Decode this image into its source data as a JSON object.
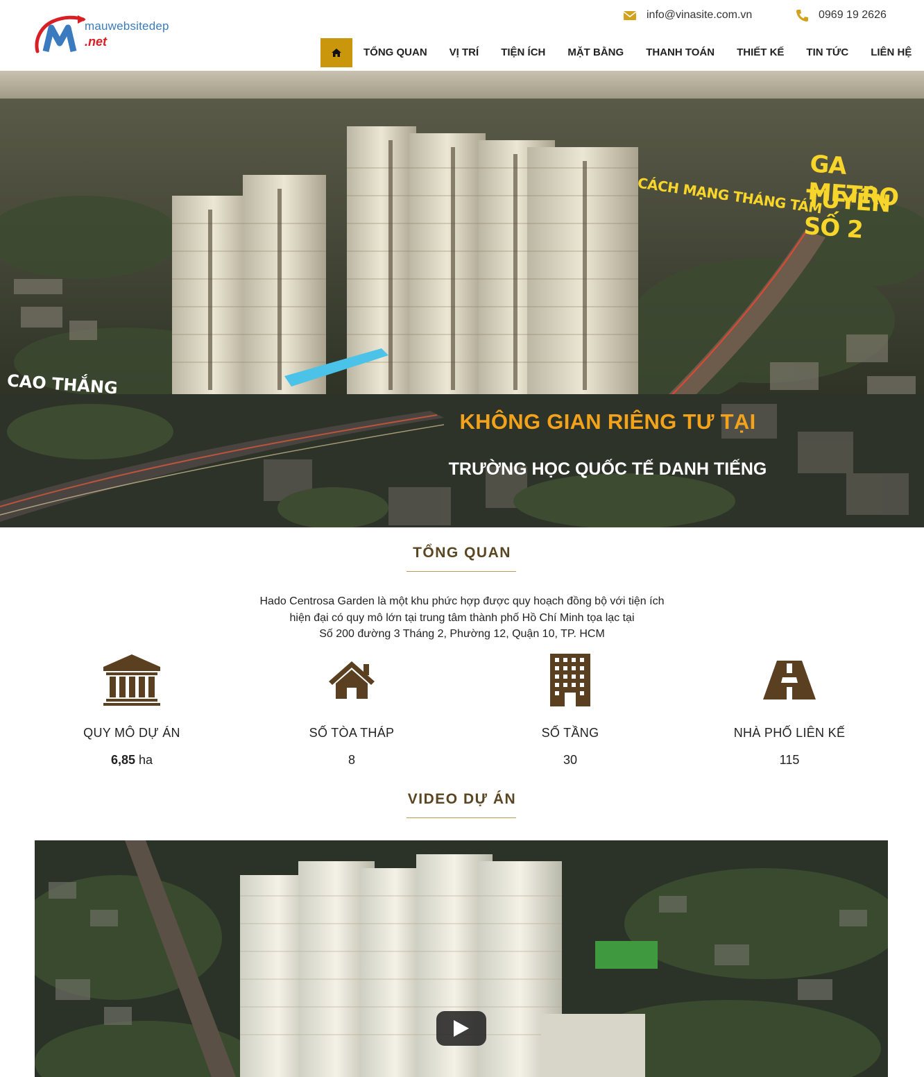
{
  "header": {
    "logo": {
      "line1": "mauwebsitedep",
      "line2": ".net"
    },
    "contact": {
      "email_icon": "envelope-icon",
      "email": "info@vinasite.com.vn",
      "phone_icon": "phone-icon",
      "phone": "0969 19 2626"
    },
    "nav": {
      "home_icon": "home-icon",
      "items": [
        "TỔNG QUAN",
        "VỊ TRÍ",
        "TIỆN ÍCH",
        "MẶT BẰNG",
        "THANH TOÁN",
        "THIẾT KẾ",
        "TIN TỨC",
        "LIÊN HỆ"
      ]
    }
  },
  "hero": {
    "headline": "KHÔNG GIAN RIÊNG TƯ TẠI",
    "subheadline": "TRƯỜNG HỌC QUỐC TẾ DANH TIẾNG",
    "overlay_metro_line1": "GA METRO",
    "overlay_metro_line2": "TUYẾN SỐ 2",
    "overlay_street": "CÁCH MẠNG THÁNG TÁM",
    "overlay_road": "CAO THẮNG"
  },
  "overview": {
    "title": "TỔNG QUAN",
    "intro_lines": [
      "Hado Centrosa Garden là một khu phức hợp được quy hoạch đồng bộ với tiện ích",
      "hiện đại có quy mô lớn tại trung tâm thành phố Hồ Chí Minh tọa lạc tại",
      "Số 200 đường 3 Tháng 2, Phường 12, Quận 10, TP. HCM"
    ],
    "stats": [
      {
        "icon": "bank-building-icon",
        "label": "QUY MÔ DỰ ÁN",
        "value_bold": "6,85",
        "value_unit": " ha"
      },
      {
        "icon": "house-icon",
        "label": "SỐ TÒA THÁP",
        "value_bold": "",
        "value_unit": "8"
      },
      {
        "icon": "tower-building-icon",
        "label": "SỐ TẦNG",
        "value_bold": "",
        "value_unit": "30"
      },
      {
        "icon": "road-icon",
        "label": "NHÀ PHỐ LIÊN KẾ",
        "value_bold": "",
        "value_unit": "115"
      }
    ]
  },
  "video": {
    "title": "VIDEO DỰ ÁN",
    "play_icon": "play-icon"
  },
  "colors": {
    "accent_gold": "#c9960c",
    "title_brown": "#5a4622",
    "icon_brown": "#5a4020",
    "hero_orange": "#f2a21b"
  }
}
